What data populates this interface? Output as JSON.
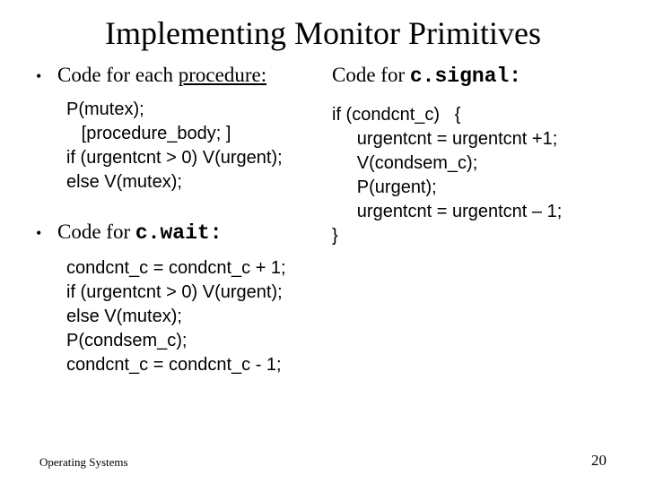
{
  "title": "Implementing Monitor Primitives",
  "left": {
    "bullet1_prefix": "Code for each ",
    "bullet1_suffix": "procedure:",
    "code1": "P(mutex);\n   [procedure_body; ]\nif (urgentcnt > 0) V(urgent);\nelse V(mutex);",
    "bullet2_prefix": "Code for  ",
    "bullet2_code": "c.wait:",
    "code2": "condcnt_c = condcnt_c + 1;\nif (urgentcnt > 0) V(urgent);\nelse V(mutex);\nP(condsem_c);\ncondcnt_c = condcnt_c - 1;"
  },
  "right": {
    "header_prefix": "Code for  ",
    "header_code": "c.signal:",
    "code": "if (condcnt_c)   {\n     urgentcnt = urgentcnt +1;\n     V(condsem_c);\n     P(urgent);\n     urgentcnt = urgentcnt – 1;\n}"
  },
  "footer": {
    "left": "Operating Systems",
    "right": "20"
  }
}
